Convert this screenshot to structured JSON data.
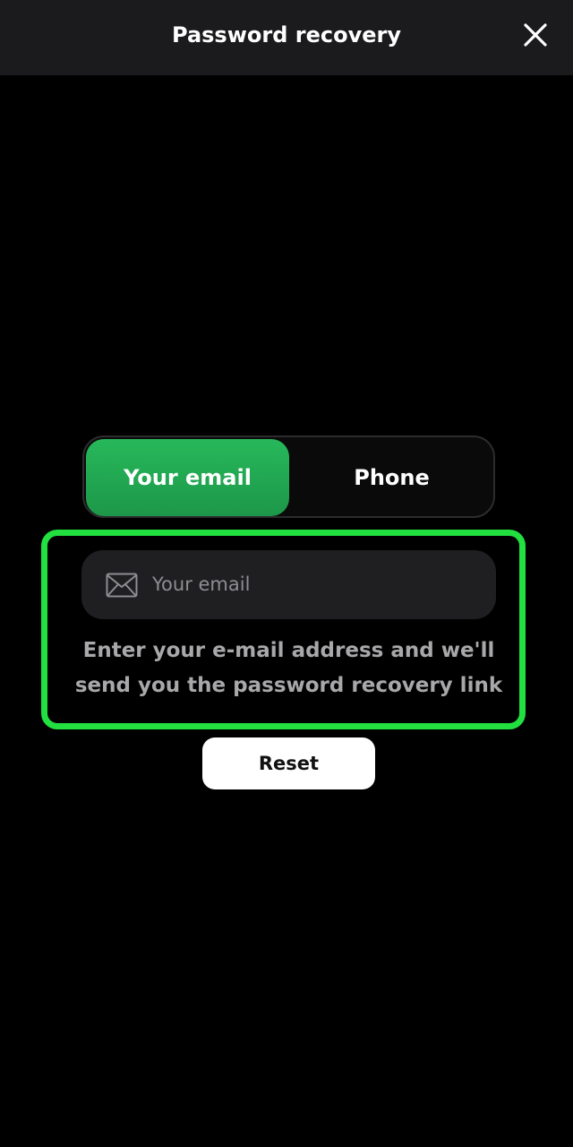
{
  "header": {
    "title": "Password recovery",
    "close_icon": "close-icon"
  },
  "tabs": [
    {
      "label": "Your email",
      "active": true
    },
    {
      "label": "Phone",
      "active": false
    }
  ],
  "email_field": {
    "icon": "mail-icon",
    "placeholder": "Your email",
    "value": ""
  },
  "hint": "Enter your e-mail address and we'll send you the password recovery link",
  "reset_button": {
    "label": "Reset"
  },
  "colors": {
    "background": "#000000",
    "header_bg": "#1b1b1d",
    "accent_green": "#27b85b",
    "highlight_outline": "#22e040",
    "field_bg": "#1f1f21",
    "hint_text": "#a8a8ab",
    "button_bg": "#ffffff"
  }
}
